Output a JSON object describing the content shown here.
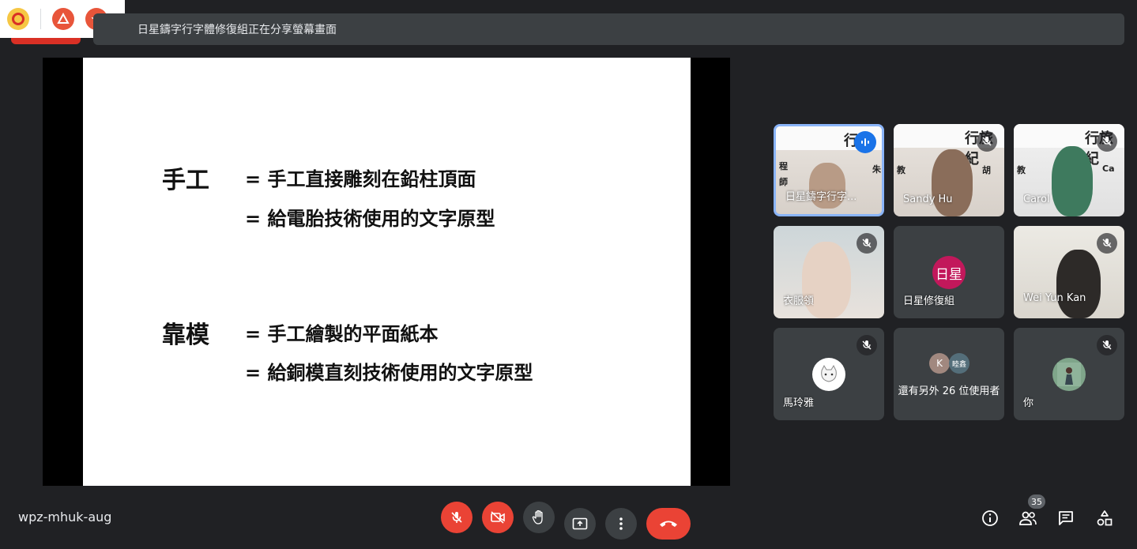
{
  "banner": {
    "text": "日星鑄字行字體修復組正在分享螢幕畫面"
  },
  "slide": {
    "term1": "手工",
    "def1a": "= 手工直接雕刻在鉛柱頂面",
    "def1b": "= 給電胎技術使用的文字原型",
    "term2": "靠模",
    "def2a": "= 手工繪製的平面紙本",
    "def2b": "= 給銅模直刻技術使用的文字原型"
  },
  "tiles": {
    "t1": {
      "name": "日星鑄字行字...",
      "strip": "行",
      "left1": "程",
      "left2": "師",
      "right1": "朱"
    },
    "t2": {
      "name": "Sandy Hu",
      "strip": "行旅紀",
      "left1": "教",
      "right1": "胡"
    },
    "t3": {
      "name": "Carol",
      "strip": "行旅紀",
      "left1": "教",
      "right1": "Ca"
    },
    "t4": {
      "name": "衣服領"
    },
    "t5": {
      "name": "日星修復組",
      "avatar": "日星"
    },
    "t6": {
      "name": "Wei Yun Kan"
    },
    "t7": {
      "name": "馬玲雅"
    },
    "t8": {
      "name": "還有另外 26 位使用者",
      "avatar_a": "K",
      "avatar_b": "睦鑫"
    },
    "t9": {
      "name": "你"
    }
  },
  "bottom": {
    "meeting_code": "wpz-mhuk-aug",
    "participant_count": "35"
  },
  "colors": {
    "accent_blue": "#1a73e8",
    "danger_red": "#ea4335",
    "avatar_pink": "#c2185b"
  }
}
